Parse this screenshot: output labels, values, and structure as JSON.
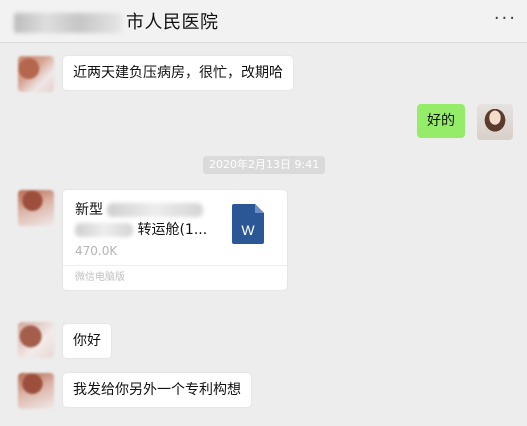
{
  "header": {
    "title_visible": "市人民医院",
    "more_icon": "more-dots-icon"
  },
  "messages": [
    {
      "text": "近两天建负压病房，很忙，改期哈"
    },
    {
      "text": "好的"
    },
    {
      "text": "你好"
    },
    {
      "text": "我发给你另外一个专利构想"
    }
  ],
  "timestamp": "2020年2月13日 9:41",
  "file": {
    "name_line1": "新型",
    "name_line2": "转运舱(1...",
    "size": "470.0K",
    "source": "微信电脑版",
    "icon_letter": "W",
    "icon_name": "word-document-icon"
  },
  "colors": {
    "chat_background": "#ededed",
    "self_bubble": "#95ec69",
    "word_icon": "#2b5797"
  }
}
